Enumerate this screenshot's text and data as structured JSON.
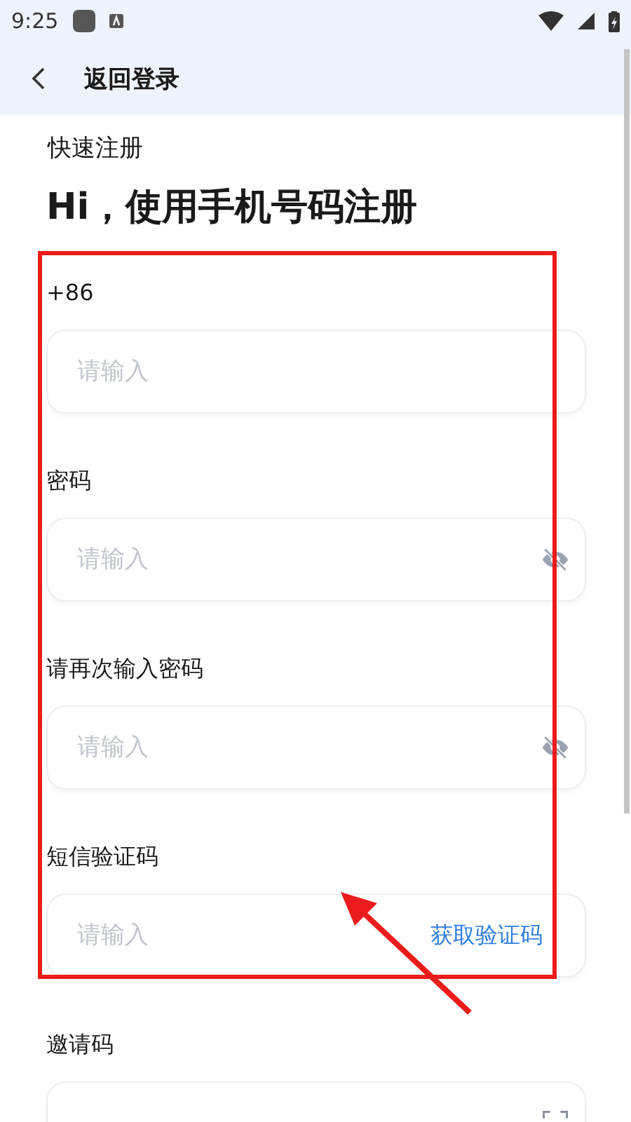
{
  "status_bar": {
    "time": "9:25"
  },
  "nav": {
    "title": "返回登录"
  },
  "subtitle": "快速注册",
  "heading": "Hi，使用手机号码注册",
  "fields": [
    {
      "kind": "plain",
      "label": "+86",
      "placeholder": "请输入"
    },
    {
      "kind": "password",
      "label": "密码",
      "placeholder": "请输入"
    },
    {
      "kind": "password",
      "label": "请再次输入密码",
      "placeholder": "请输入"
    },
    {
      "kind": "code",
      "label": "短信验证码",
      "placeholder": "请输入",
      "action": "获取验证码"
    },
    {
      "kind": "scan",
      "label": "邀请码"
    }
  ]
}
